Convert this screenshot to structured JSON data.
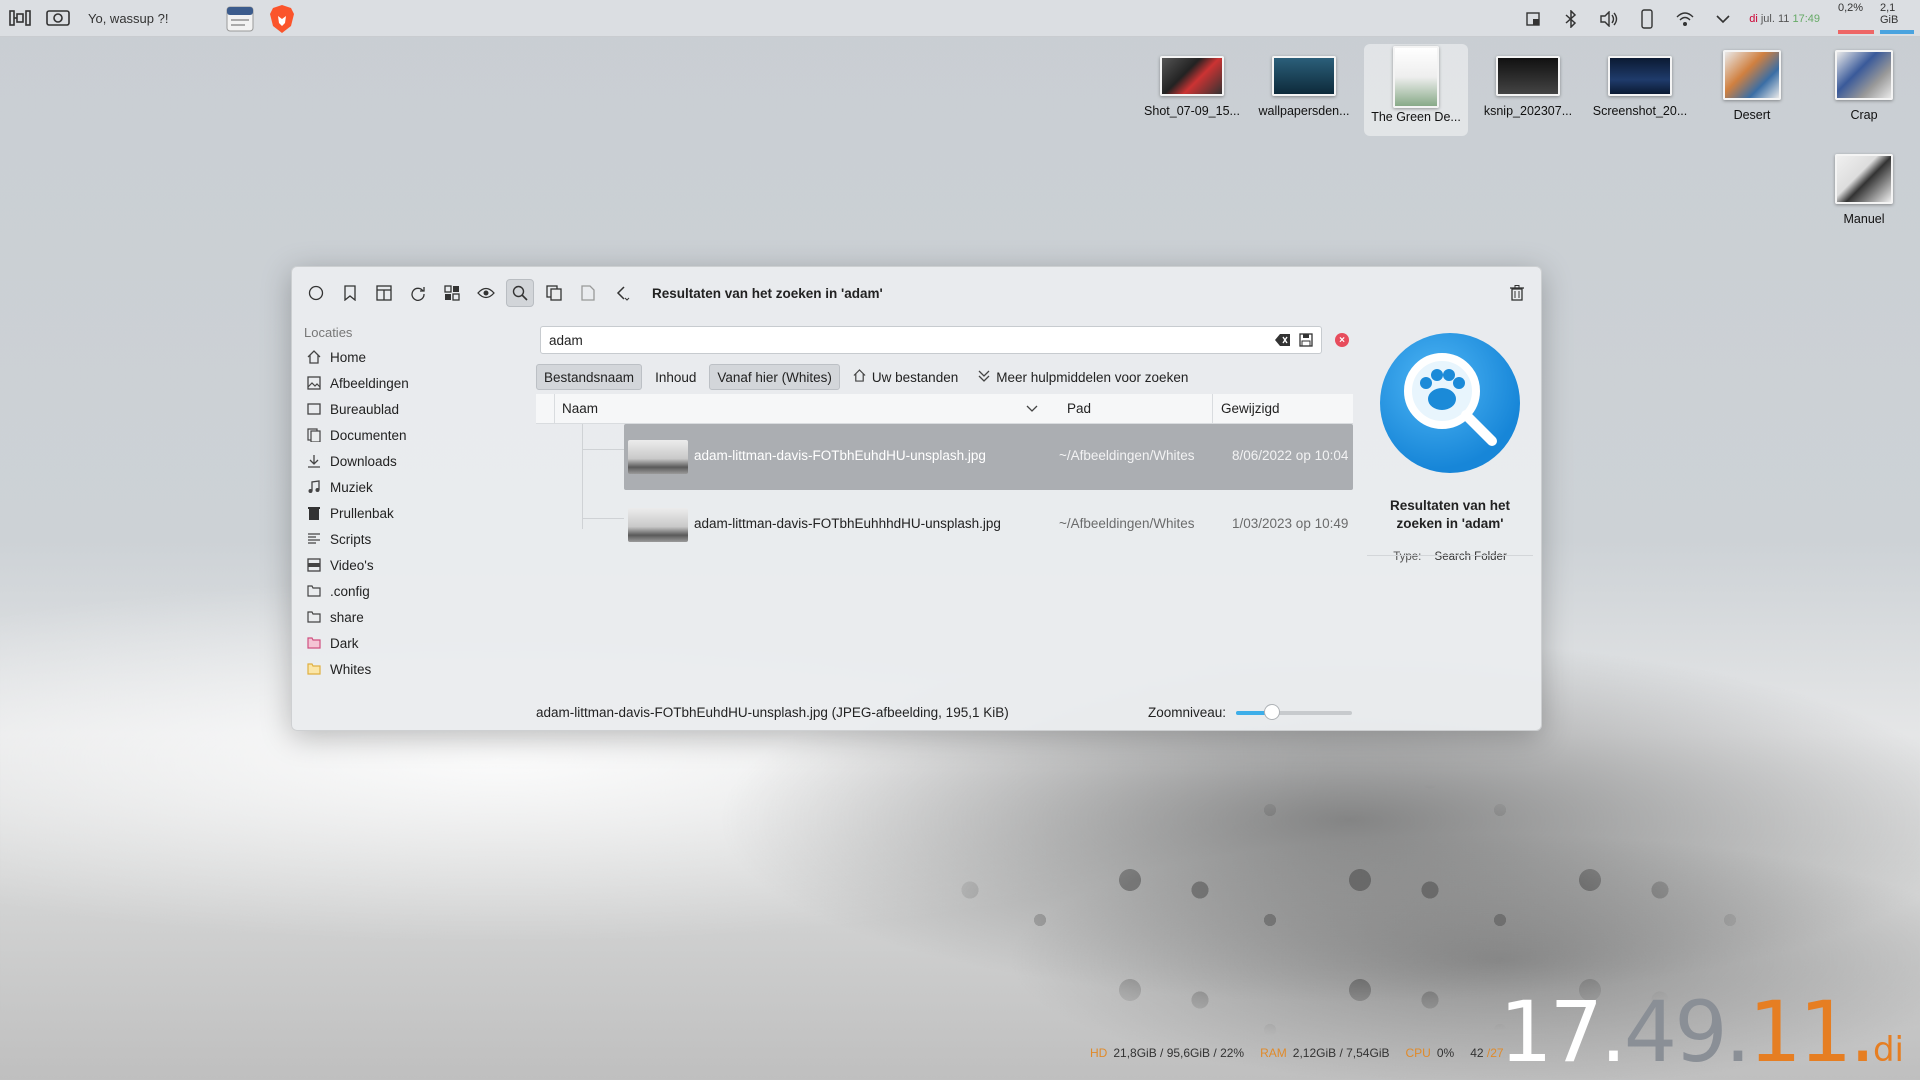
{
  "topbar": {
    "title": "Yo, wassup ?!",
    "date_day": "di",
    "date_text": "jul. 11",
    "time": "17:49",
    "cpu_percent": "0,2%",
    "mem_used": "2,1 GiB"
  },
  "desktop": {
    "icons": [
      {
        "label": "Shot_07-09_15..."
      },
      {
        "label": "wallpapersden..."
      },
      {
        "label": "The Green De..."
      },
      {
        "label": "ksnip_202307..."
      },
      {
        "label": "Screenshot_20..."
      },
      {
        "label": "Desert"
      },
      {
        "label": "Crap"
      },
      {
        "label": "Manuel"
      }
    ]
  },
  "window": {
    "title": "Resultaten van het zoeken in 'adam'",
    "sidebar": {
      "header": "Locaties",
      "items": [
        {
          "label": "Home",
          "icon": "home-icon"
        },
        {
          "label": "Afbeeldingen",
          "icon": "pictures-icon"
        },
        {
          "label": "Bureaublad",
          "icon": "desktop-icon"
        },
        {
          "label": "Documenten",
          "icon": "documents-icon"
        },
        {
          "label": "Downloads",
          "icon": "download-icon"
        },
        {
          "label": "Muziek",
          "icon": "music-icon"
        },
        {
          "label": "Prullenbak",
          "icon": "trash-icon"
        },
        {
          "label": "Scripts",
          "icon": "scripts-icon"
        },
        {
          "label": "Video's",
          "icon": "video-icon"
        },
        {
          "label": ".config",
          "icon": "folder-icon"
        },
        {
          "label": "share",
          "icon": "folder-icon"
        },
        {
          "label": "Dark",
          "icon": "folder-pink-icon"
        },
        {
          "label": "Whites",
          "icon": "folder-yellow-icon"
        }
      ]
    },
    "search": {
      "value": "adam"
    },
    "filters": {
      "filename": "Bestandsnaam",
      "content": "Inhoud",
      "from_here": "Vanaf hier (Whites)",
      "your_files": "Uw bestanden",
      "more_tools": "Meer hulpmiddelen voor zoeken"
    },
    "columns": {
      "name": "Naam",
      "path": "Pad",
      "modified": "Gewijzigd"
    },
    "rows": [
      {
        "name": "adam-littman-davis-FOTbhEuhdHU-unsplash.jpg",
        "path": "~/Afbeeldingen/Whites",
        "modified": "8/06/2022 op 10:04",
        "selected": true
      },
      {
        "name": "adam-littman-davis-FOTbhEuhhhdHU-unsplash.jpg",
        "path": "~/Afbeeldingen/Whites",
        "modified": "1/03/2023 op 10:49",
        "selected": false
      }
    ],
    "info": {
      "title": "Resultaten van het zoeken in 'adam'",
      "type_label": "Type:",
      "type_value": "Search Folder"
    },
    "status": "adam-littman-davis-FOTbhEuhdHU-unsplash.jpg (JPEG-afbeelding, 195,1 KiB)",
    "zoom_label": "Zoomniveau:",
    "zoom_level": 0.28
  },
  "conky": {
    "hd_label": "HD",
    "hd_value": "21,8GiB / 95,6GiB / 22%",
    "ram_label": "RAM",
    "ram_value": "2,12GiB / 7,54GiB",
    "cpu_label": "CPU",
    "cpu_value": "0%",
    "temp_a": "42",
    "temp_b": "/27"
  },
  "clock": {
    "hour": "17.",
    "minute": "49.",
    "second": "11.",
    "day": "di"
  },
  "colors": {
    "accent": "#3daee9",
    "clock_accent": "#e67e22",
    "close": "#e74c5c"
  }
}
